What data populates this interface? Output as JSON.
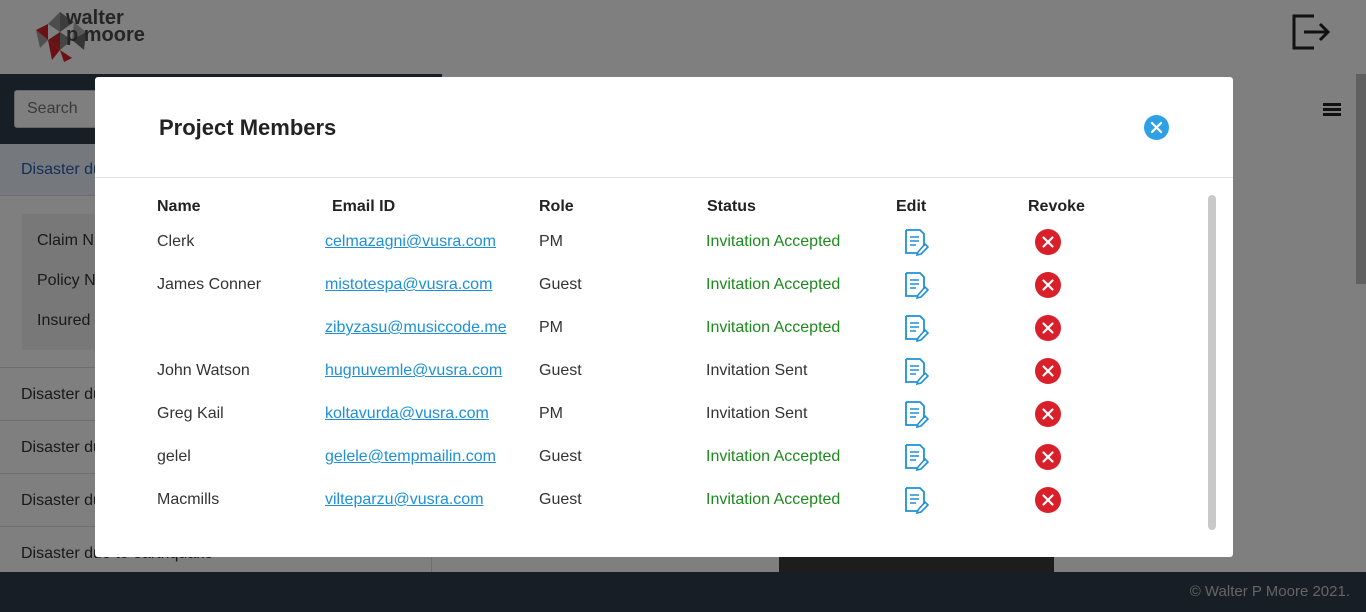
{
  "header": {
    "logo_line1": "walter",
    "logo_line2": "p moore"
  },
  "sidebar": {
    "search_placeholder": "Search",
    "active_item": "Disaster du",
    "details": [
      "Claim N",
      "Policy N",
      "Insured"
    ],
    "items": [
      "Disaster du",
      "Disaster du",
      "Disaster du",
      "Disaster due to earthquake"
    ]
  },
  "footer": {
    "copyright": "© Walter P Moore 2021."
  },
  "modal": {
    "title": "Project Members",
    "columns": [
      "Name",
      "Email ID",
      "Role",
      "Status",
      "Edit",
      "Revoke"
    ],
    "rows": [
      {
        "name": "Clerk",
        "email": "celmazagni@vusra.com",
        "role": "PM",
        "status": "Invitation Accepted"
      },
      {
        "name": "James Conner",
        "email": "mistotespa@vusra.com",
        "role": "Guest",
        "status": "Invitation Accepted"
      },
      {
        "name": "",
        "email": "zibyzasu@musiccode.me",
        "role": "PM",
        "status": "Invitation Accepted"
      },
      {
        "name": "John Watson",
        "email": "hugnuvemle@vusra.com",
        "role": "Guest",
        "status": "Invitation Sent"
      },
      {
        "name": "Greg Kail",
        "email": "koltavurda@vusra.com",
        "role": "PM",
        "status": "Invitation Sent"
      },
      {
        "name": "gelel",
        "email": "gelele@tempmailin.com",
        "role": "Guest",
        "status": "Invitation Accepted"
      },
      {
        "name": "Macmills",
        "email": "vilteparzu@vusra.com",
        "role": "Guest",
        "status": "Invitation Accepted"
      }
    ]
  },
  "colors": {
    "accepted": "#1d8a1d",
    "link": "#1e90d8",
    "revoke": "#d9202a",
    "close": "#2ea1e6"
  }
}
